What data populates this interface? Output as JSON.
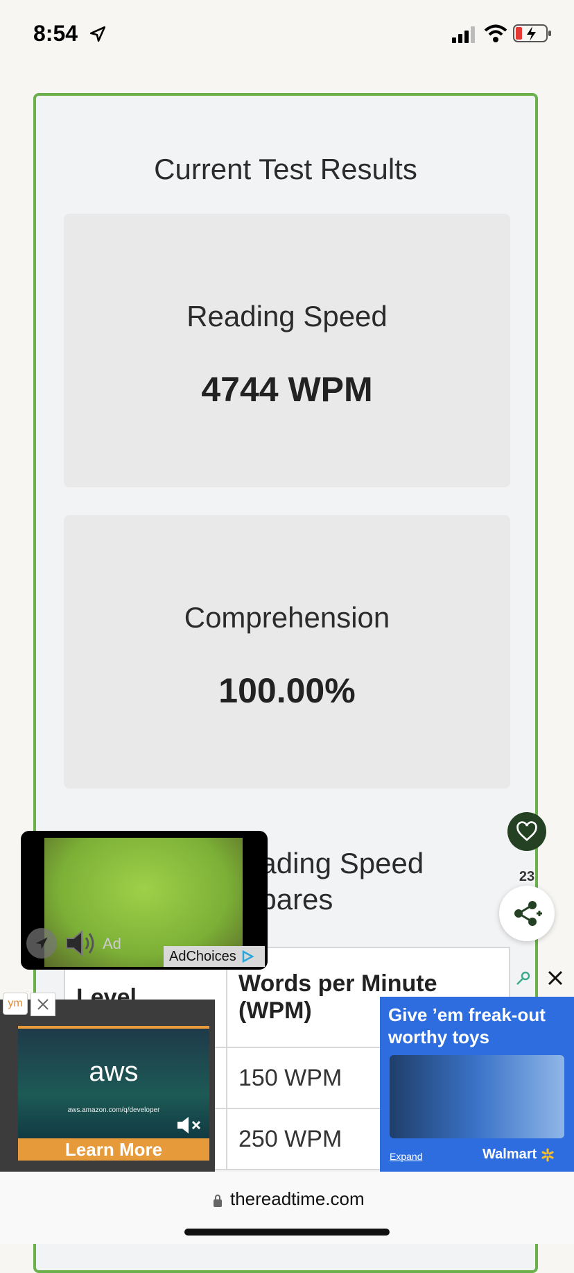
{
  "status": {
    "time": "8:54"
  },
  "results": {
    "title": "Current Test Results",
    "reading_speed_label": "Reading Speed",
    "reading_speed_value": "4744 WPM",
    "comprehension_label": "Comprehension",
    "comprehension_value": "100.00%"
  },
  "compare": {
    "title_line1": "eading Speed",
    "title_line2": "npares",
    "headers": [
      "Level",
      "Words per Minute (WPM)"
    ],
    "rows": [
      {
        "level": "",
        "wpm": "150 WPM"
      },
      {
        "level": "",
        "wpm": "250 WPM"
      }
    ]
  },
  "social": {
    "share_count": "23"
  },
  "video_ad": {
    "ad_label": "Ad",
    "adchoices": "AdChoices"
  },
  "aws_ad": {
    "badge": "ym",
    "logo": "aws",
    "url": "aws.amazon.com/q/developer",
    "cta": "Learn More"
  },
  "walmart_ad": {
    "headline": "Give ’em freak-out worthy toys",
    "expand": "Expand",
    "brand": "Walmart"
  },
  "browser": {
    "url": "thereadtime.com"
  }
}
